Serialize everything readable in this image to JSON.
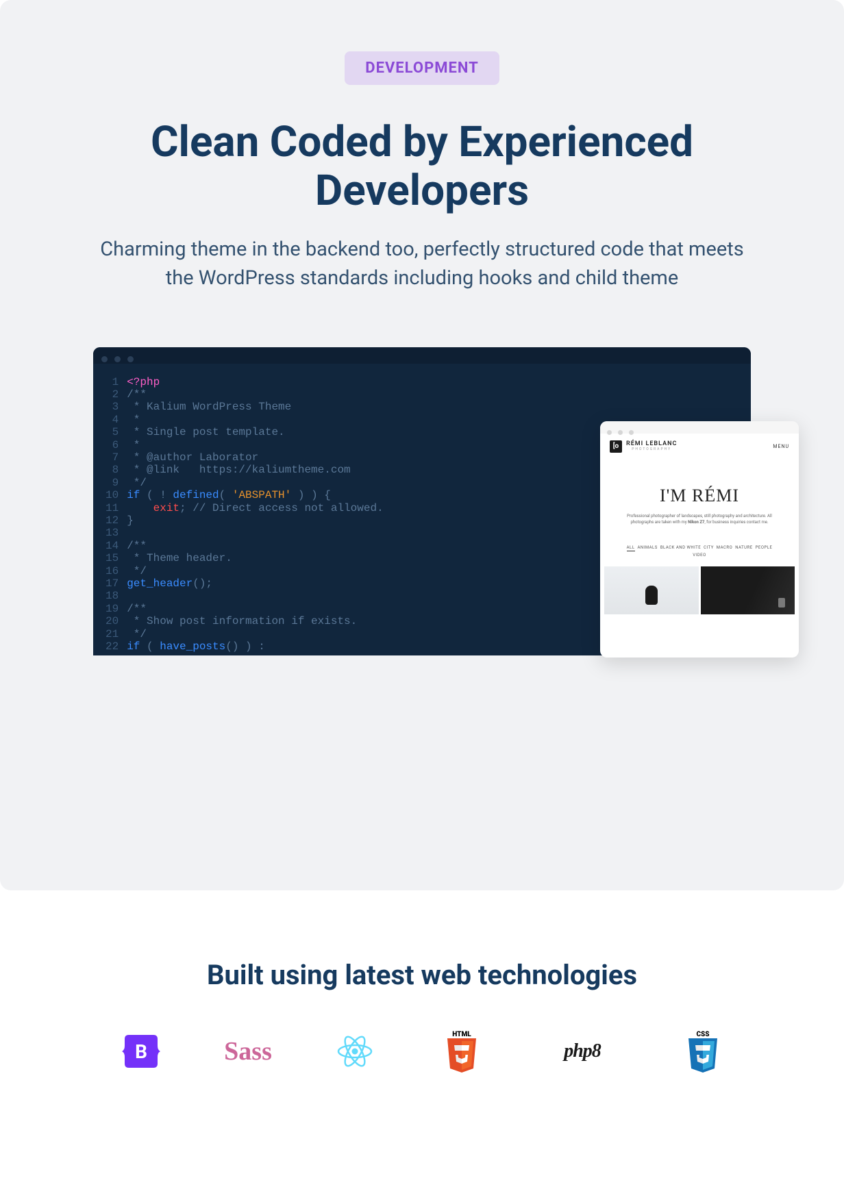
{
  "badge": "DEVELOPMENT",
  "title": "Clean Coded by Experienced Developers",
  "subtitle": "Charming theme in the backend too, perfectly structured code that meets the WordPress standards including hooks and child theme",
  "code_lines": [
    "1",
    "2",
    "3",
    "4",
    "5",
    "6",
    "7",
    "8",
    "9",
    "10",
    "11",
    "12",
    "13",
    "14",
    "15",
    "16",
    "17",
    "18",
    "19",
    "20",
    "21",
    "22"
  ],
  "code": {
    "l1": "<?php",
    "l2": "/**",
    "l3": " * Kalium WordPress Theme",
    "l4": " *",
    "l5": " * Single post template.",
    "l6": " *",
    "l7": " * @author Laborator",
    "l8": " * @link   https://kaliumtheme.com",
    "l9": " */",
    "l10a": "if",
    "l10b": " ( ! ",
    "l10c": "defined",
    "l10d": "( ",
    "l10e": "'ABSPATH'",
    "l10f": " ) ) {",
    "l11a": "    ",
    "l11b": "exit",
    "l11c": "; // Direct access not allowed.",
    "l12": "}",
    "l14": "/**",
    "l15": " * Theme header.",
    "l16": " */",
    "l17a": "get_header",
    "l17b": "();",
    "l19": "/**",
    "l20": " * Show post information if exists.",
    "l21": " */",
    "l22a": "if",
    "l22b": " ( ",
    "l22c": "have_posts",
    "l22d": "() ) :"
  },
  "preview": {
    "site_name": "RÉMI LEBLANC",
    "site_tag": "PHOTOGRAPHY",
    "menu": "MENU",
    "hero_title": "I'M RÉMI",
    "hero_sub_a": "Professional photographer of landscapes, still photography and architecture. All photographs are taken with my ",
    "hero_sub_b": "Nikon Z7",
    "hero_sub_c": ", for business inquiries contact me.",
    "cats": {
      "all": "ALL",
      "animals": "ANIMALS",
      "bw": "BLACK AND WHITE",
      "city": "CITY",
      "macro": "MACRO",
      "nature": "NATURE",
      "people": "PEOPLE",
      "video": "VIDEO"
    }
  },
  "section2_title": "Built using latest web technologies",
  "tech": {
    "bootstrap": "B",
    "sass": "Sass",
    "html_label": "HTML",
    "php8": "php8",
    "css_label": "CSS"
  }
}
